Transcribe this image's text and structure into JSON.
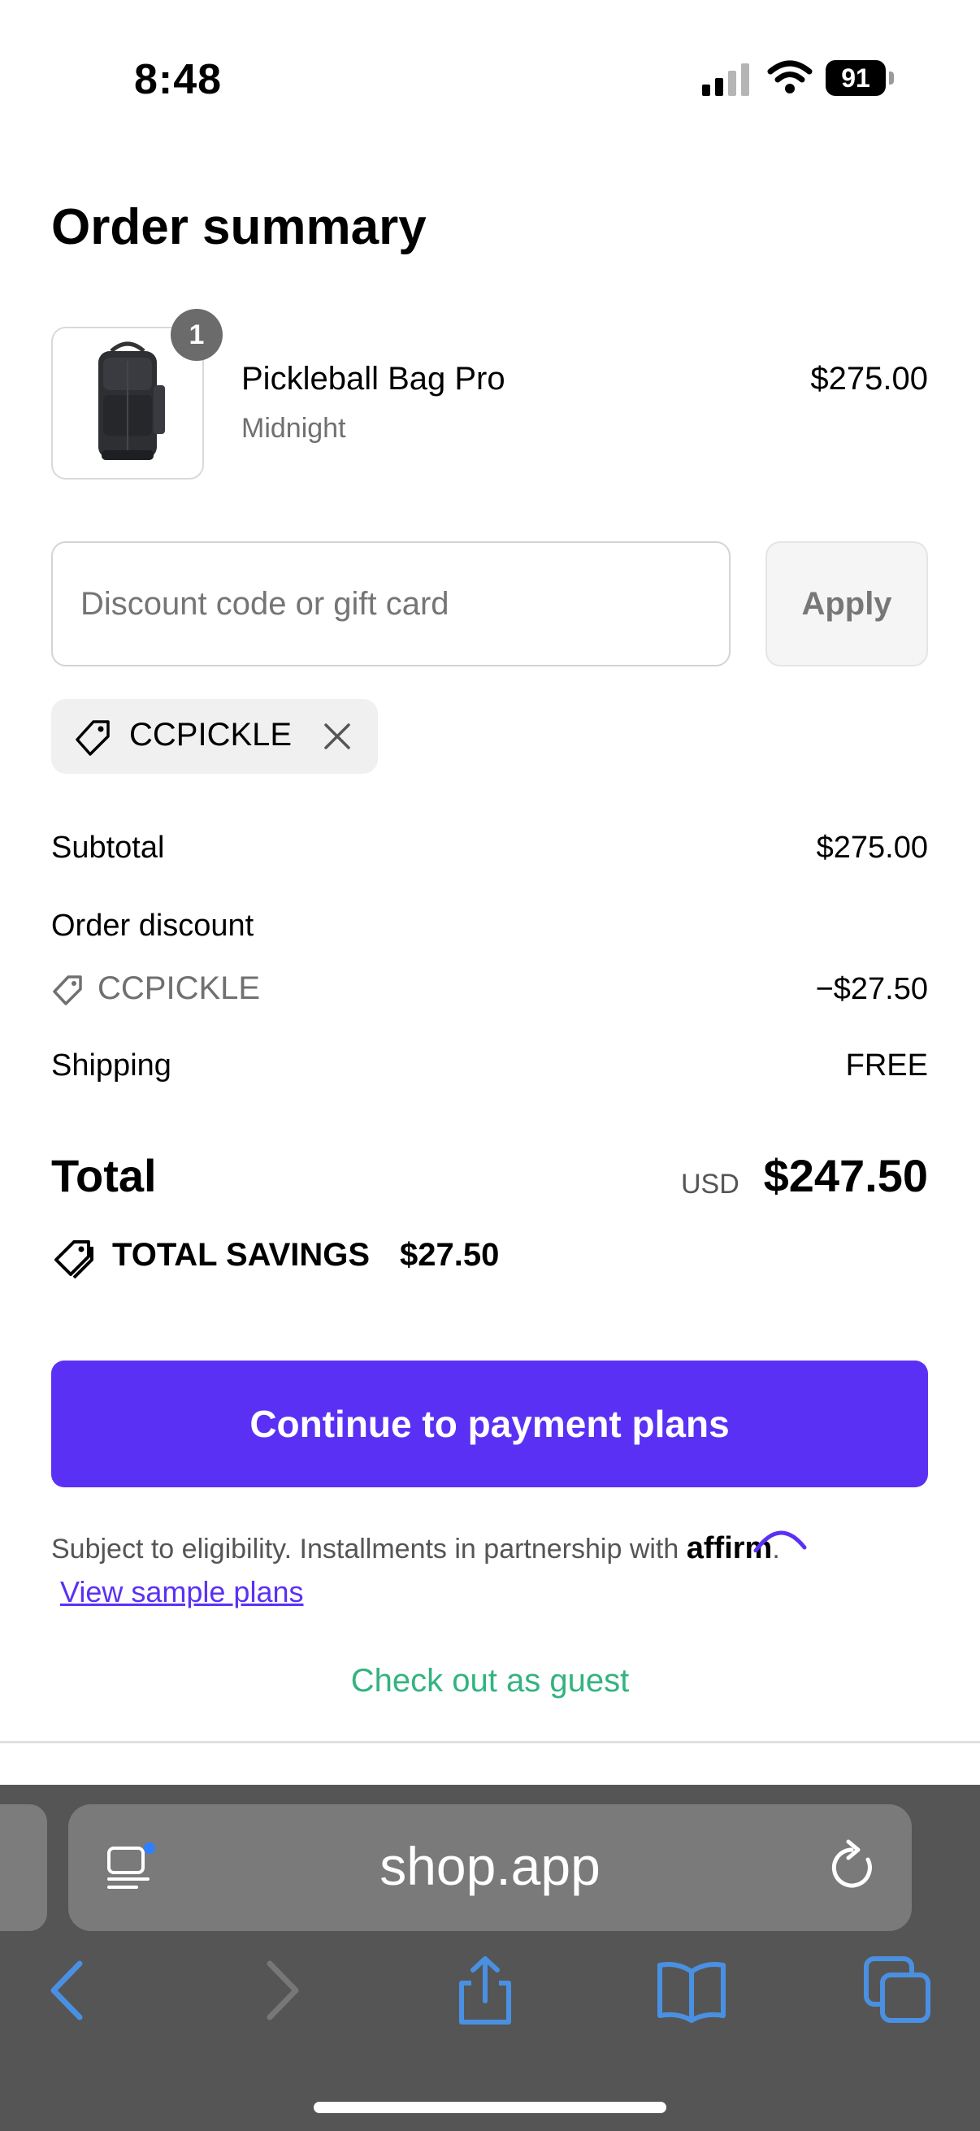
{
  "status_bar": {
    "time": "8:48",
    "battery": "91"
  },
  "page": {
    "title": "Order summary"
  },
  "product": {
    "name": "Pickleball Bag Pro",
    "variant": "Midnight",
    "price": "$275.00",
    "quantity": "1"
  },
  "discount": {
    "placeholder": "Discount code or gift card",
    "apply_label": "Apply",
    "applied_code": "CCPICKLE"
  },
  "summary": {
    "subtotal_label": "Subtotal",
    "subtotal_value": "$275.00",
    "order_discount_label": "Order discount",
    "discount_code": "CCPICKLE",
    "discount_value": "−$27.50",
    "shipping_label": "Shipping",
    "shipping_value": "FREE"
  },
  "total": {
    "label": "Total",
    "currency": "USD",
    "value": "$247.50"
  },
  "savings": {
    "label": "TOTAL SAVINGS",
    "value": "$27.50"
  },
  "payment": {
    "button_label": "Continue to payment plans",
    "fine_print": "Subject to eligibility. Installments in partnership with",
    "partner": "affirm",
    "sample_link": "View sample plans"
  },
  "guest_link": "Check out as guest",
  "browser": {
    "url": "shop.app"
  },
  "colors": {
    "accent": "#5a31f4",
    "guest_link": "#33b37f",
    "safari_bar": "#555555",
    "safari_icon": "#4a90e2"
  },
  "icons": [
    "signal-icon",
    "wifi-icon",
    "battery-icon",
    "tag-icon",
    "close-icon",
    "savings-tag-icon",
    "reader-icon",
    "reload-icon",
    "back-icon",
    "forward-icon",
    "share-icon",
    "bookmarks-icon",
    "tabs-icon"
  ]
}
